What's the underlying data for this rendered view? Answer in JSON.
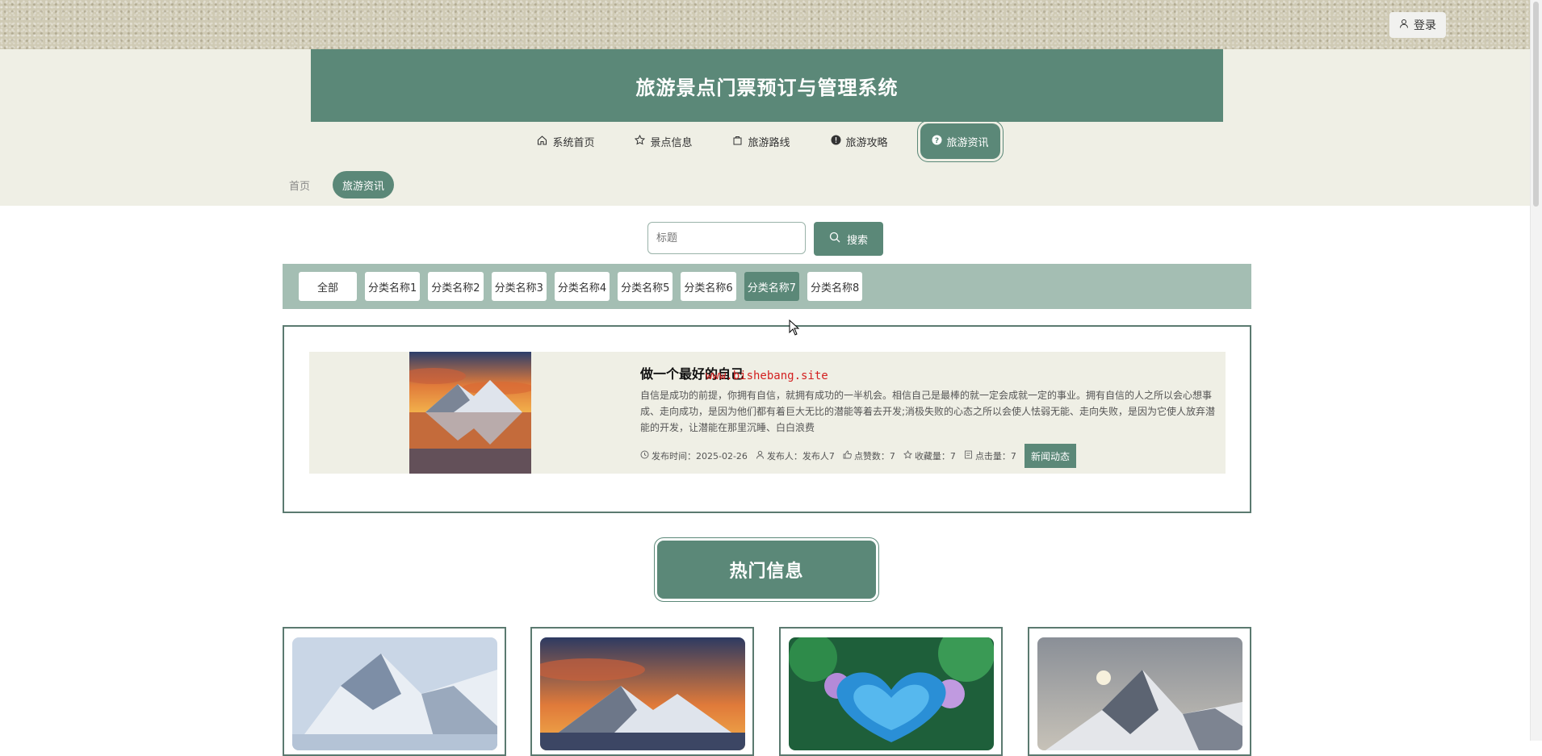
{
  "header": {
    "login_label": "登录",
    "site_title": "旅游景点门票预订与管理系统"
  },
  "nav": {
    "items": [
      {
        "label": "系统首页",
        "icon": "home-icon"
      },
      {
        "label": "景点信息",
        "icon": "star-icon"
      },
      {
        "label": "旅游路线",
        "icon": "bag-icon"
      },
      {
        "label": "旅游攻略",
        "icon": "info-icon"
      },
      {
        "label": "旅游资讯",
        "icon": "question-icon",
        "active": true
      }
    ]
  },
  "breadcrumb": {
    "home": "首页",
    "current": "旅游资讯"
  },
  "search": {
    "placeholder": "标题",
    "button_label": "搜索"
  },
  "categories": {
    "items": [
      "全部",
      "分类名称1",
      "分类名称2",
      "分类名称3",
      "分类名称4",
      "分类名称5",
      "分类名称6",
      "分类名称7",
      "分类名称8"
    ],
    "active_index": 7
  },
  "news": {
    "title": "做一个最好的自己",
    "watermark": "www.bishebang.site",
    "description": "自信是成功的前提，你拥有自信，就拥有成功的一半机会。相信自己是最棒的就一定会成就一定的事业。拥有自信的人之所以会心想事成、走向成功，是因为他们都有着巨大无比的潜能等着去开发;消极失败的心态之所以会使人怯弱无能、走向失败，是因为它使人放弃潜能的开发，让潜能在那里沉睡、白白浪费",
    "meta": {
      "publish_time": "发布时间：2025-02-26",
      "publisher": "发布人：发布人7",
      "likes": "点赞数：7",
      "favorites": "收藏量：7",
      "clicks": "点击量：7"
    },
    "tag": "新闻动态"
  },
  "hot": {
    "title": "热门信息"
  },
  "colors": {
    "primary": "#5b8878",
    "category_bar": "#a4beb3",
    "header_band": "#efefe5"
  }
}
